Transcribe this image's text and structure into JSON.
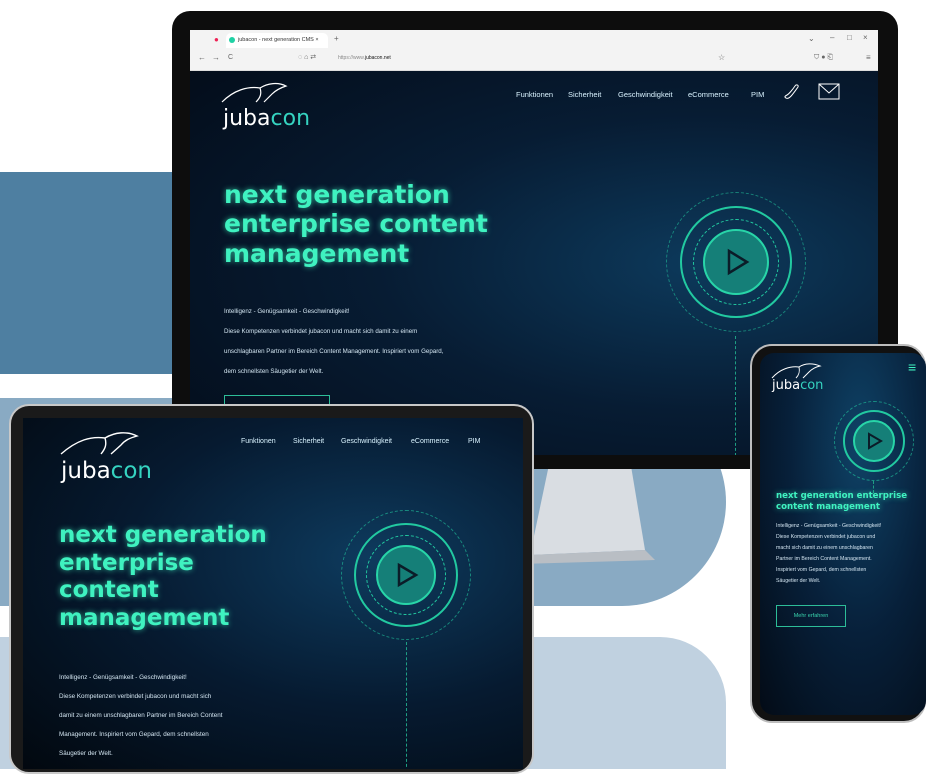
{
  "colors": {
    "accent": "#3ff2c0",
    "band_dark": "#4e7fa1",
    "band_mid": "#89aac3",
    "band_light": "#c0d1e0"
  },
  "browser": {
    "tab_title": "jubacon - next generation CMS ×",
    "new_tab": "+",
    "url_prefix": "https://www.",
    "url_domain": "jubacon.net",
    "back": "←",
    "forward": "→",
    "reload": "C",
    "min": "–",
    "max": "□",
    "close": "×",
    "dropdown": "⌄",
    "star": "☆",
    "menu": "≡"
  },
  "brand": {
    "prefix": "juba",
    "suffix": "con"
  },
  "desktop": {
    "nav": [
      "Funktionen",
      "Sicherheit",
      "Geschwindigkeit",
      "eCommerce",
      "PIM"
    ],
    "headline": [
      "next generation",
      "enterprise content",
      "management"
    ],
    "tagline": "Intelligenz - Genügsamkeit - Geschwindigkeit!",
    "body": [
      "Diese Kompetenzen verbindet jubacon und macht sich damit zu einem",
      "unschlagbaren Partner im Bereich Content Management. Inspiriert vom Gepard,",
      "dem schnellsten Säugetier der Welt."
    ]
  },
  "tablet": {
    "nav": [
      "Funktionen",
      "Sicherheit",
      "Geschwindigkeit",
      "eCommerce",
      "PIM"
    ],
    "headline": [
      "next generation",
      "enterprise",
      "content",
      "management"
    ],
    "tagline": "Intelligenz - Genügsamkeit - Geschwindigkeit!",
    "body": [
      "Diese Kompetenzen verbindet jubacon und macht sich",
      "damit zu einem unschlagbaren Partner im Bereich Content",
      "Management. Inspiriert vom Gepard, dem schnellsten",
      "Säugetier der Welt."
    ]
  },
  "phone": {
    "menu": "≡",
    "headline": [
      "next generation enterprise",
      "content management"
    ],
    "tagline": "Intelligenz - Genügsamkeit - Geschwindigkeit!",
    "body": [
      "Diese Kompetenzen verbindet jubacon und",
      "macht sich damit zu einem unschlagbaren",
      "Partner im Bereich Content Management.",
      "Inspiriert vom Gepard, dem schnellsten",
      "Säugetier der Welt."
    ],
    "button": "Mehr erfahren"
  }
}
